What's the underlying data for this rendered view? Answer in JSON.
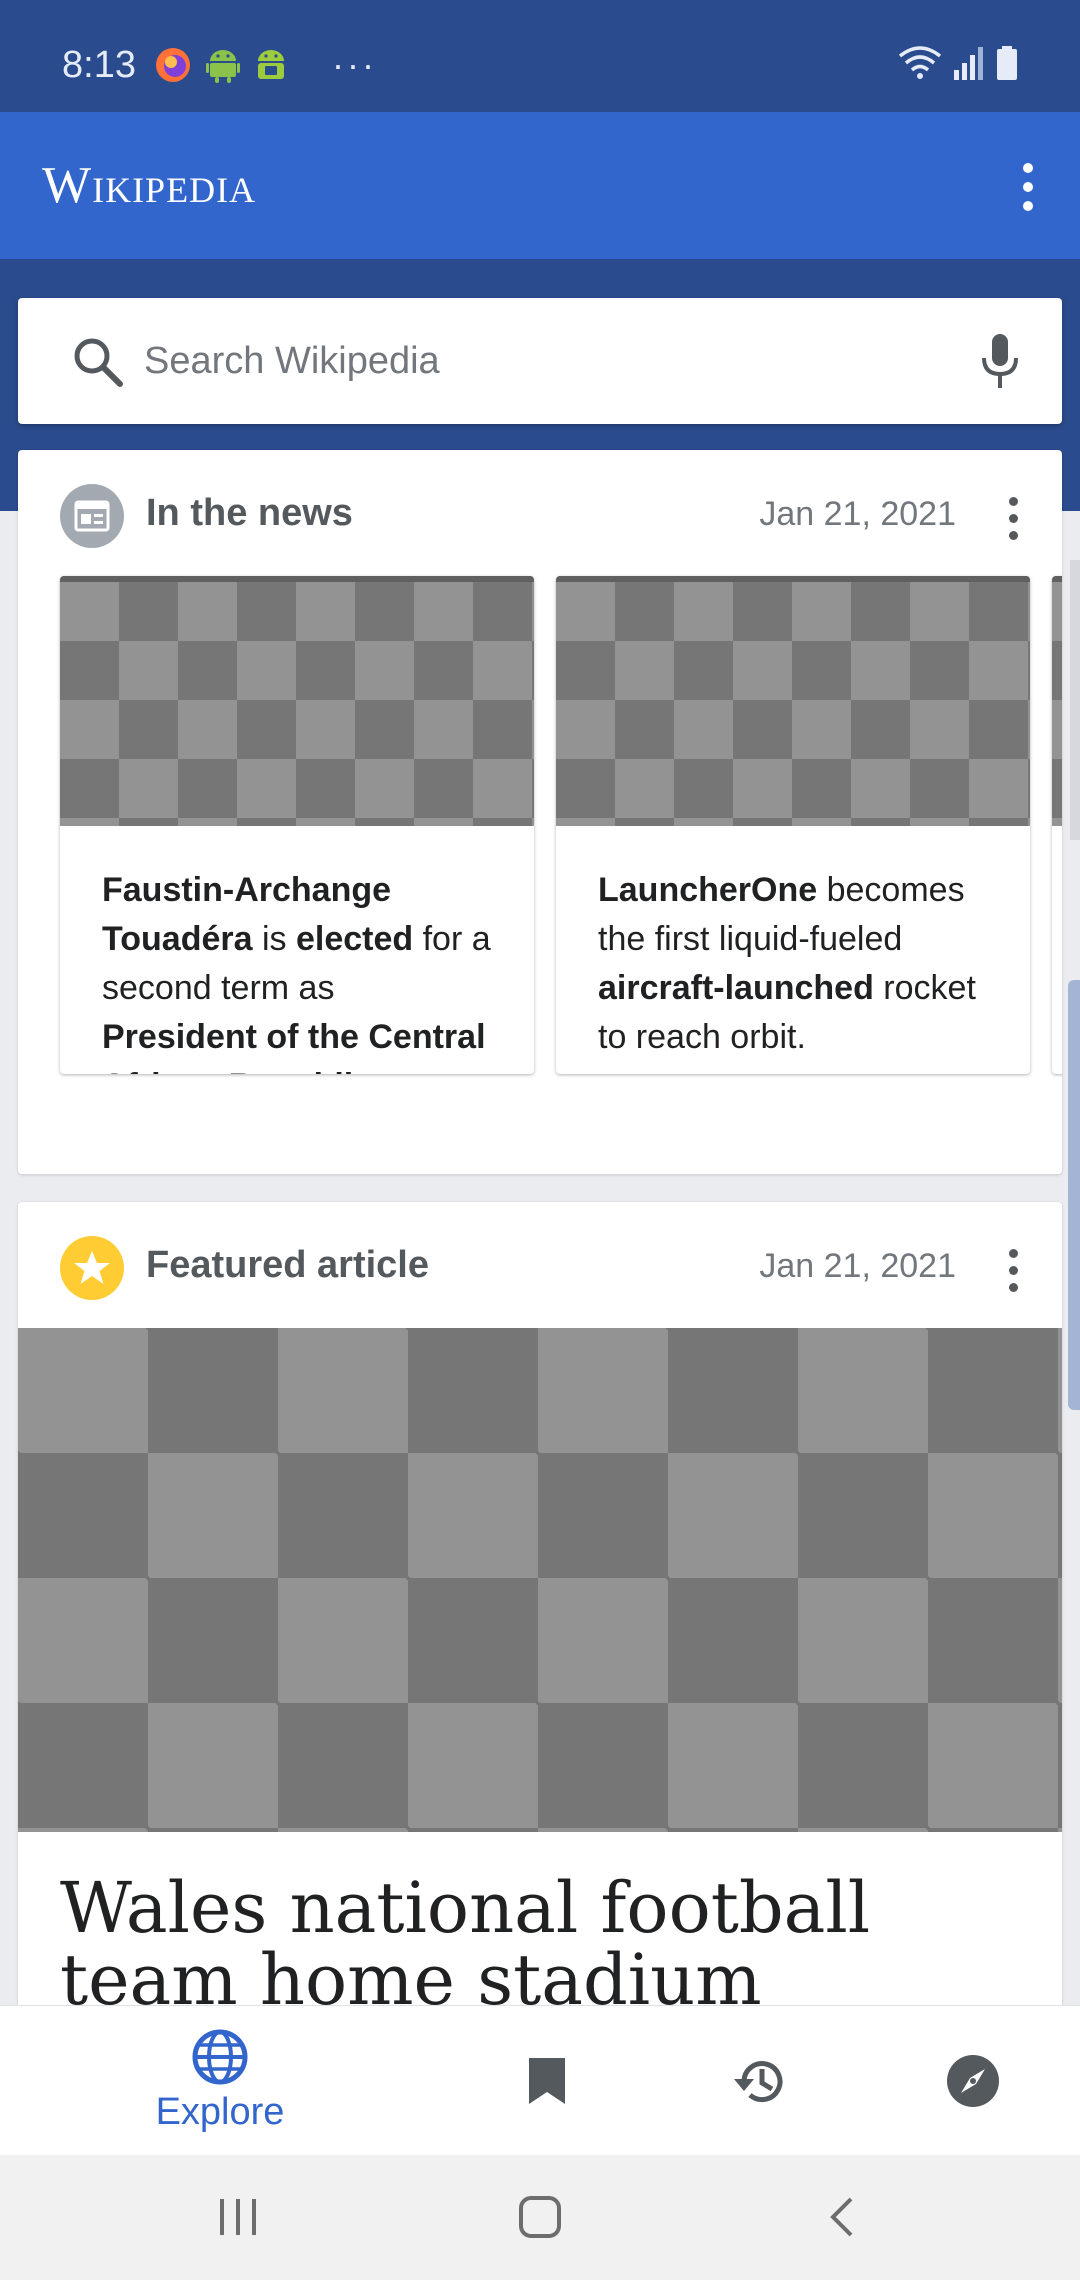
{
  "status_bar": {
    "time": "8:13",
    "more_indicator": "···",
    "icons_left": [
      "firefox-icon",
      "android-icon",
      "android-debug-icon"
    ],
    "icons_right": [
      "wifi-icon",
      "signal-icon",
      "battery-icon"
    ]
  },
  "app_bar": {
    "wordmark": "Wikipedia",
    "menu_icon": "more-vert-icon",
    "color": "#3366cc"
  },
  "search": {
    "placeholder": "Search Wikipedia",
    "search_icon": "search-icon",
    "mic_icon": "mic-icon"
  },
  "news_card": {
    "title": "In the news",
    "date": "Jan 21, 2021",
    "icon": "newspaper-icon",
    "items": [
      {
        "segments": [
          {
            "text": "Faustin-Archange Touadéra",
            "bold": true
          },
          {
            "text": " is ",
            "bold": false
          },
          {
            "text": "elected",
            "bold": true
          },
          {
            "text": " for a second term as ",
            "bold": false
          },
          {
            "text": "President of the Central African Republic",
            "bold": true
          },
          {
            "text": ".",
            "bold": false
          }
        ]
      },
      {
        "segments": [
          {
            "text": "LauncherOne",
            "bold": true
          },
          {
            "text": " becomes the first liquid-fueled ",
            "bold": false
          },
          {
            "text": "aircraft-launched",
            "bold": true
          },
          {
            "text": " rocket to reach orbit.",
            "bold": false
          }
        ]
      }
    ]
  },
  "featured_card": {
    "title": "Featured article",
    "date": "Jan 21, 2021",
    "icon": "star-icon",
    "article_title": "Wales national football team home stadium"
  },
  "bottom_nav": {
    "explore_label": "Explore",
    "items": [
      "globe-icon",
      "bookmark-icon",
      "history-icon",
      "compass-icon"
    ],
    "active_color": "#3366cc"
  },
  "system_nav": [
    "recents-icon",
    "home-icon",
    "back-icon"
  ]
}
